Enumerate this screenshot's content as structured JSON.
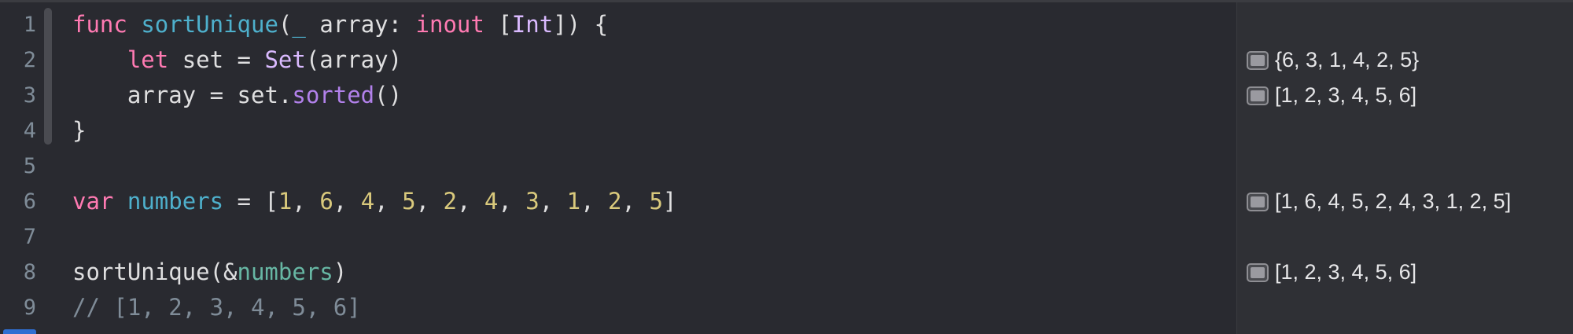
{
  "gutter": {
    "line_numbers": [
      "1",
      "2",
      "3",
      "4",
      "5",
      "6",
      "7",
      "8",
      "9"
    ]
  },
  "code": {
    "line1": {
      "kw_func": "func",
      "fn_name": "sortUnique",
      "open": "(",
      "underscore": "_",
      "param": " array: ",
      "kw_inout": "inout",
      "space": " ",
      "bracket_open": "[",
      "type_int": "Int",
      "bracket_close": "]) {"
    },
    "line2": {
      "indent": "    ",
      "kw_let": "let",
      "rest1": " set = ",
      "type_set": "Set",
      "rest2": "(array)"
    },
    "line3": {
      "indent": "    ",
      "rest1": "array = set.",
      "method_sorted": "sorted",
      "rest2": "()"
    },
    "line4": {
      "brace": "}"
    },
    "line6": {
      "kw_var": "var",
      "space": " ",
      "var_name": "numbers",
      "assign": " = [",
      "values": [
        "1",
        "6",
        "4",
        "5",
        "2",
        "4",
        "3",
        "1",
        "2",
        "5"
      ],
      "sep": ", ",
      "close": "]"
    },
    "line8": {
      "call": "sortUnique(&",
      "var_ref": "numbers",
      "close": ")"
    },
    "line9": {
      "comment": "// [1, 2, 3, 4, 5, 6]"
    }
  },
  "results": [
    {
      "line": 2,
      "icon": "quicklook-icon",
      "text": "{6, 3, 1, 4, 2, 5}"
    },
    {
      "line": 3,
      "icon": "quicklook-icon",
      "text": "[1, 2, 3, 4, 5, 6]"
    },
    {
      "line": 6,
      "icon": "quicklook-icon",
      "text": "[1, 6, 4, 5, 2, 4, 3, 1, 2, 5]"
    },
    {
      "line": 8,
      "icon": "quicklook-icon",
      "text": "[1, 2, 3, 4, 5, 6]"
    }
  ],
  "colors": {
    "background": "#292a30",
    "results_background": "#2f3035",
    "keyword": "#ff7ab2",
    "declaration": "#4eb0cc",
    "type": "#dabaff",
    "method": "#b281eb",
    "number": "#d9c97c",
    "variable": "#67b7a4",
    "comment": "#7f8c98",
    "text": "#dfdfe0"
  }
}
